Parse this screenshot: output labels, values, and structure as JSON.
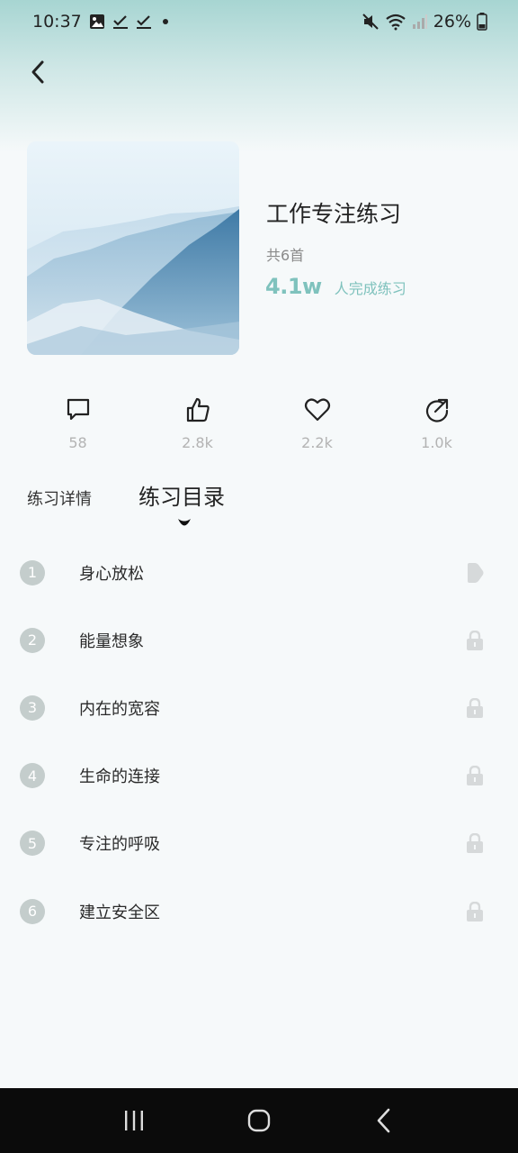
{
  "status_bar": {
    "time": "10:37",
    "battery": "26%",
    "left_icons": [
      "image-icon",
      "check-icon",
      "check-icon",
      "dot-icon"
    ],
    "right_icons": [
      "mute-icon",
      "wifi-icon",
      "signal-icon",
      "battery-icon"
    ]
  },
  "header": {
    "back_icon": "chevron-left-icon"
  },
  "course": {
    "title": "工作专注练习",
    "count": "共6首",
    "completed_number": "4.1w",
    "completed_label": "人完成练习"
  },
  "stats": [
    {
      "icon": "comment-icon",
      "value": "58"
    },
    {
      "icon": "thumbs-up-icon",
      "value": "2.8k"
    },
    {
      "icon": "heart-icon",
      "value": "2.2k"
    },
    {
      "icon": "share-icon",
      "value": "1.0k"
    }
  ],
  "tabs": {
    "details": "练习详情",
    "catalog": "练习目录"
  },
  "tracks": [
    {
      "num": "1",
      "title": "身心放松",
      "action": "play-icon"
    },
    {
      "num": "2",
      "title": "能量想象",
      "action": "lock-icon"
    },
    {
      "num": "3",
      "title": "内在的宽容",
      "action": "lock-icon"
    },
    {
      "num": "4",
      "title": "生命的连接",
      "action": "lock-icon"
    },
    {
      "num": "5",
      "title": "专注的呼吸",
      "action": "lock-icon"
    },
    {
      "num": "6",
      "title": "建立安全区",
      "action": "lock-icon"
    }
  ],
  "colors": {
    "accent": "#7fc2bd",
    "header_gradient": "#a7d5d2",
    "stat_text": "#b3b3b3",
    "badge": "#c4cdcc",
    "nav_bar": "#0b0b0b"
  },
  "nav_bar": {
    "icons": [
      "recents-icon",
      "home-icon",
      "back-icon"
    ]
  }
}
